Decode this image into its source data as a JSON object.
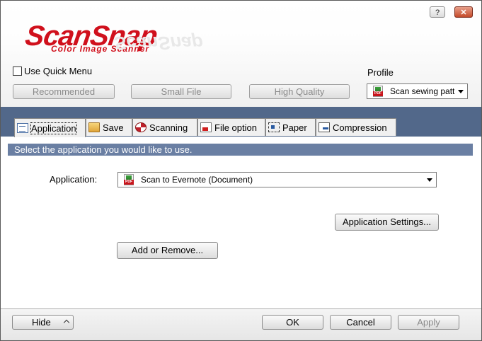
{
  "window": {
    "help_button": "?",
    "close_button": "✕"
  },
  "logo": {
    "main": "ScanSnap",
    "sub": "Color Image Scanner"
  },
  "quick_menu": {
    "label": "Use Quick Menu",
    "checked": false
  },
  "presets": [
    "Recommended",
    "Small File",
    "High Quality"
  ],
  "profile": {
    "label": "Profile",
    "selected": "Scan sewing patt",
    "icon": "pdf-icon"
  },
  "tabs": [
    {
      "label": "Application",
      "icon": "application-icon",
      "active": true
    },
    {
      "label": "Save",
      "icon": "folder-icon"
    },
    {
      "label": "Scanning",
      "icon": "scanning-icon"
    },
    {
      "label": "File option",
      "icon": "file-option-icon"
    },
    {
      "label": "Paper",
      "icon": "paper-icon"
    },
    {
      "label": "Compression",
      "icon": "compression-icon"
    }
  ],
  "application_tab": {
    "instruction": "Select the application you would like to use.",
    "application_label": "Application:",
    "application_selected": "Scan to Evernote (Document)",
    "application_settings_button": "Application Settings...",
    "add_remove_button": "Add or Remove..."
  },
  "footer": {
    "hide": "Hide",
    "ok": "OK",
    "cancel": "Cancel",
    "apply": "Apply"
  },
  "colors": {
    "brand_red": "#d0101c",
    "tab_band": "#52688a",
    "instruction_bar": "#6a7fa3"
  }
}
